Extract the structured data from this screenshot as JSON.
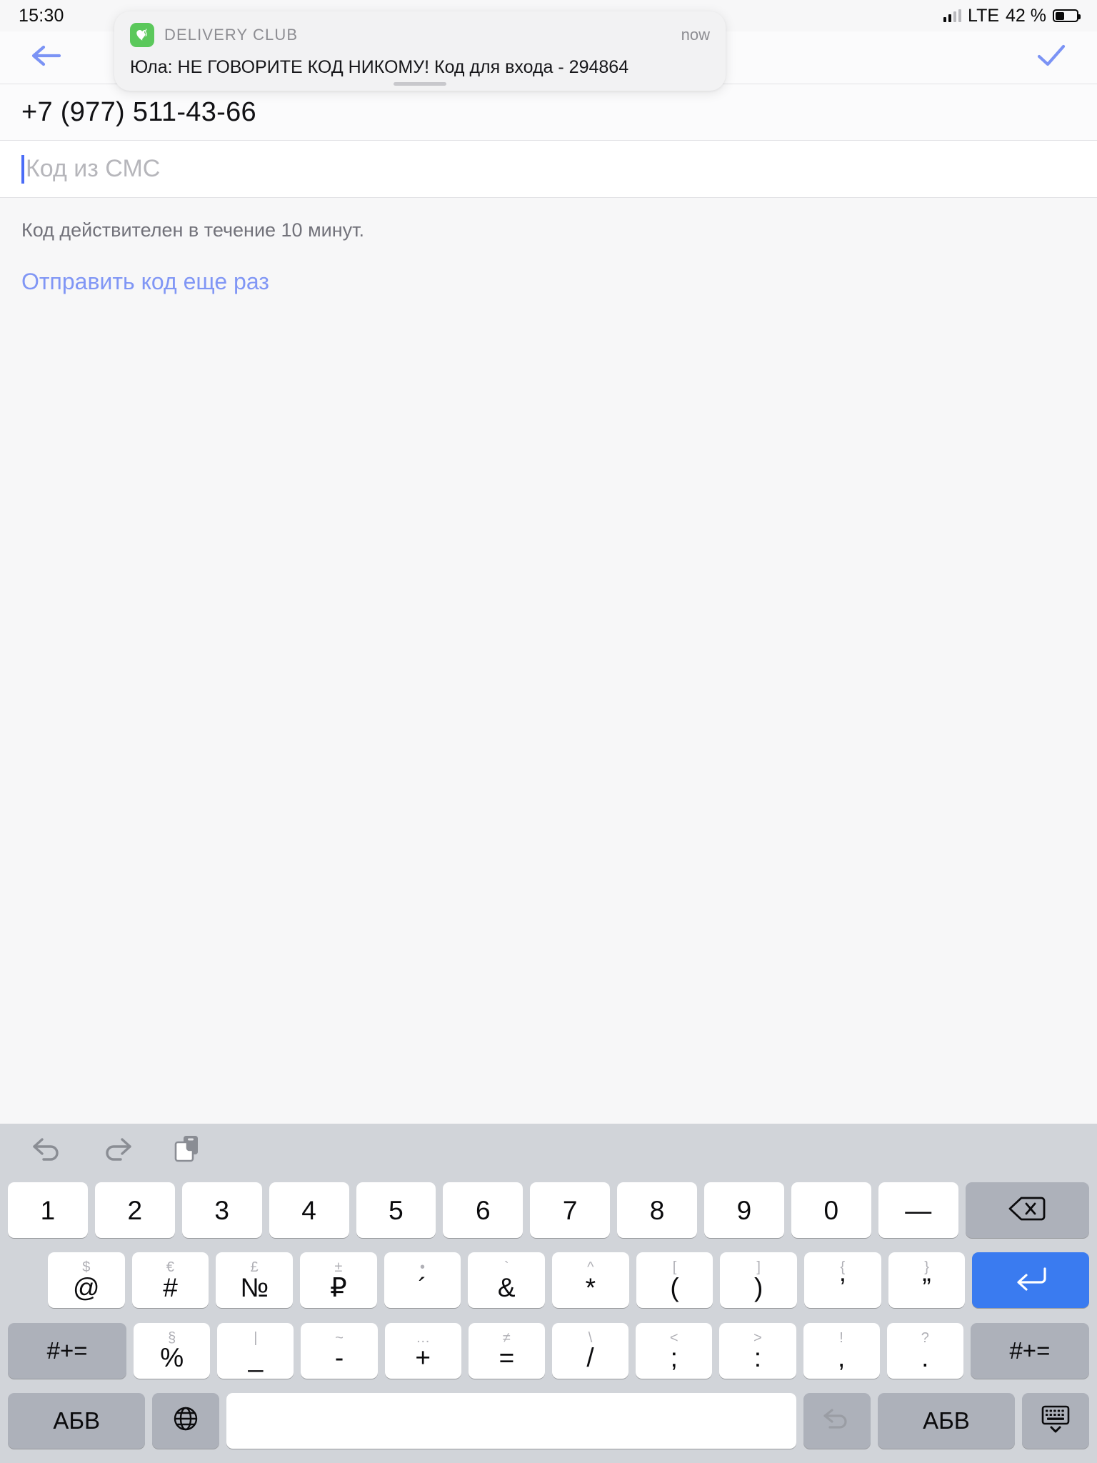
{
  "status_bar": {
    "time": "15:30",
    "network": "LTE",
    "battery_percent": "42 %",
    "battery_level": 42,
    "signal_icon": "cellular-signal-icon",
    "battery_icon": "battery-icon"
  },
  "nav": {
    "back_icon": "back-arrow-icon",
    "done_icon": "checkmark-icon",
    "accent_color": "#7b93f5"
  },
  "notification": {
    "app_name": "DELIVERY CLUB",
    "time": "now",
    "message": "Юла: НЕ ГОВОРИТЕ КОД НИКОМУ! Код для входа - 294864",
    "app_icon": "delivery-club-icon",
    "icon_color": "#5bc85b"
  },
  "form": {
    "phone_value": "+7 (977) 511-43-66",
    "code_placeholder": "Код из СМС",
    "code_value": "",
    "hint": "Код действителен в течение 10 минут.",
    "resend_label": "Отправить код еще раз",
    "resend_color": "#8096f5",
    "caret_color": "#4a6cf7"
  },
  "keyboard": {
    "toolbar": [
      {
        "name": "undo-icon",
        "label": "undo"
      },
      {
        "name": "redo-icon",
        "label": "redo"
      },
      {
        "name": "paste-icon",
        "label": "paste"
      }
    ],
    "row1": [
      {
        "main": "1"
      },
      {
        "main": "2"
      },
      {
        "main": "3"
      },
      {
        "main": "4"
      },
      {
        "main": "5"
      },
      {
        "main": "6"
      },
      {
        "main": "7"
      },
      {
        "main": "8"
      },
      {
        "main": "9"
      },
      {
        "main": "0"
      },
      {
        "main": "—"
      }
    ],
    "row1_backspace": "backspace-icon",
    "row2": [
      {
        "main": "@",
        "sub": "$"
      },
      {
        "main": "#",
        "sub": "€"
      },
      {
        "main": "№",
        "sub": "£"
      },
      {
        "main": "₽",
        "sub": "±"
      },
      {
        "main": "´",
        "sub": "•"
      },
      {
        "main": "&",
        "sub": "`"
      },
      {
        "main": "*",
        "sub": "^"
      },
      {
        "main": "(",
        "sub": "["
      },
      {
        "main": ")",
        "sub": "]"
      },
      {
        "main": "’",
        "sub": "{"
      },
      {
        "main": "”",
        "sub": "}"
      }
    ],
    "row2_return": "return-icon",
    "row3_left_label": "#+=",
    "row3": [
      {
        "main": "%",
        "sub": "§"
      },
      {
        "main": "_",
        "sub": "|"
      },
      {
        "main": "-",
        "sub": "~"
      },
      {
        "main": "+",
        "sub": "…"
      },
      {
        "main": "=",
        "sub": "≠"
      },
      {
        "main": "/",
        "sub": "\\"
      },
      {
        "main": ";",
        "sub": "<"
      },
      {
        "main": ":",
        "sub": ">"
      },
      {
        "main": ",",
        "sub": "!"
      },
      {
        "main": ".",
        "sub": "?"
      }
    ],
    "row3_right_label": "#+=",
    "row4": {
      "abc_left": "АБВ",
      "globe_icon": "globe-icon",
      "space": "",
      "dictation_undo_icon": "undo-arrow-icon",
      "abc_right": "АБВ",
      "hide_keyboard_icon": "hide-keyboard-icon"
    },
    "bg_color": "#d1d4d9",
    "key_color": "#ffffff",
    "gray_key_color": "#adb1ba",
    "return_key_color": "#3a7bf0"
  }
}
